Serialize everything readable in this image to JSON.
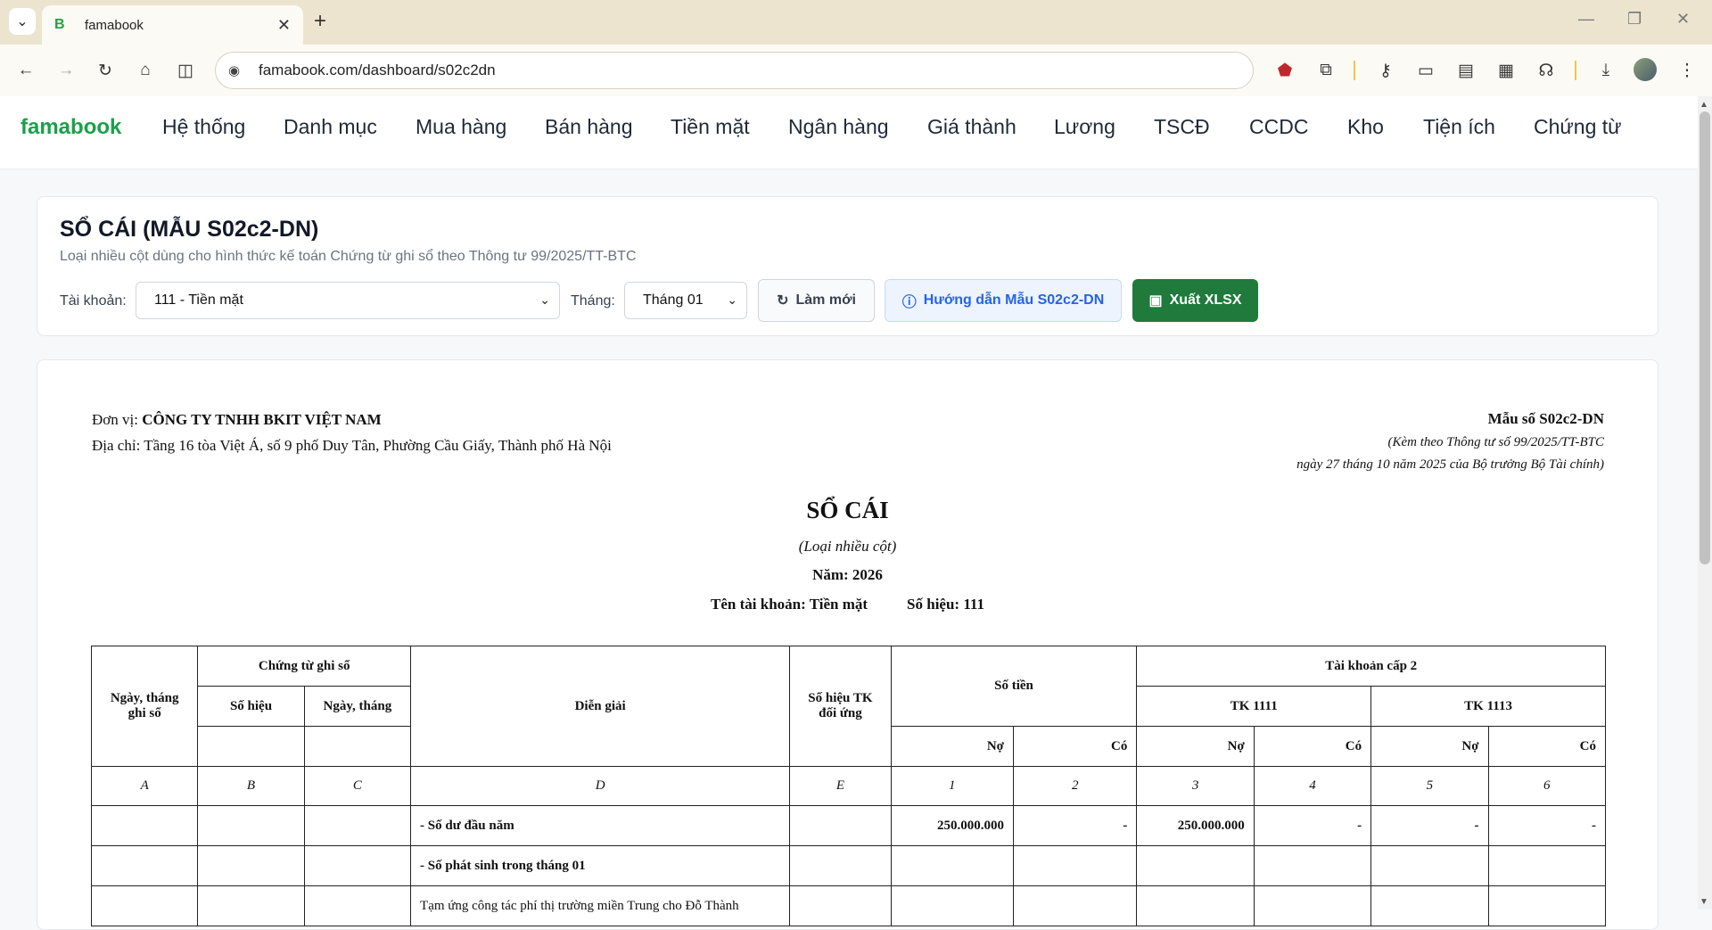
{
  "browser": {
    "tab_title": "famabook",
    "favicon_letter": "B",
    "new_tab": "+",
    "url": "famabook.com/dashboard/s02c2dn"
  },
  "nav": {
    "brand": "famabook",
    "items": [
      "Hệ thống",
      "Danh mục",
      "Mua hàng",
      "Bán hàng",
      "Tiền mặt",
      "Ngân hàng",
      "Giá thành",
      "Lương",
      "TSCĐ",
      "CCDC",
      "Kho",
      "Tiện ích",
      "Chứng từ"
    ]
  },
  "header": {
    "title": "SỔ CÁI (MẪU S02c2-DN)",
    "subtitle": "Loại nhiều cột dùng cho hình thức kế toán Chứng từ ghi sổ theo Thông tư 99/2025/TT-BTC",
    "account_label": "Tài khoản:",
    "account_value": "111 - Tiền mặt",
    "month_label": "Tháng:",
    "month_value": "Tháng 01",
    "refresh_label": "Làm mới",
    "guide_label": "Hướng dẫn Mẫu S02c2-DN",
    "export_label": "Xuất XLSX"
  },
  "doc": {
    "unit_label": "Đơn vị:",
    "unit_name": "CÔNG TY TNHH BKIT VIỆT NAM",
    "address_label": "Địa chỉ:",
    "address": "Tầng 16 tòa Việt Á, số 9 phố Duy Tân, Phường Cầu Giấy, Thành phố Hà Nội",
    "form_no": "Mẫu số S02c2-DN",
    "form_note1": "(Kèm theo Thông tư số 99/2025/TT-BTC",
    "form_note2": "ngày 27 tháng 10 năm 2025 của Bộ trưởng Bộ Tài chính)",
    "title": "SỔ CÁI",
    "type": "(Loại nhiều cột)",
    "year": "Năm: 2026",
    "account_name": "Tên tài khoản: Tiền mặt",
    "account_code": "Số hiệu: 111"
  },
  "table": {
    "h_date": "Ngày, tháng ghi sổ",
    "h_voucher": "Chứng từ ghi sổ",
    "h_voucher_no": "Số hiệu",
    "h_voucher_date": "Ngày, tháng",
    "h_desc": "Diễn giải",
    "h_contra": "Số hiệu TK đối ứng",
    "h_amount": "Số tiền",
    "h_sub": "Tài khoản cấp 2",
    "h_tk1": "TK 1111",
    "h_tk2": "TK 1113",
    "h_debit": "Nợ",
    "h_credit": "Có",
    "idx": [
      "A",
      "B",
      "C",
      "D",
      "E",
      "1",
      "2",
      "3",
      "4",
      "5",
      "6"
    ],
    "rows": [
      {
        "desc": "- Số dư đầu năm",
        "v": [
          "250.000.000",
          "-",
          "250.000.000",
          "-",
          "-",
          "-"
        ]
      },
      {
        "desc": "- Số phát sinh trong tháng 01",
        "v": [
          "",
          "",
          "",
          "",
          "",
          ""
        ]
      },
      {
        "desc": "Tạm ứng công tác phí thị trường miền Trung cho Đỗ Thành",
        "v": [
          "",
          "",
          "",
          "",
          "",
          ""
        ]
      }
    ]
  }
}
